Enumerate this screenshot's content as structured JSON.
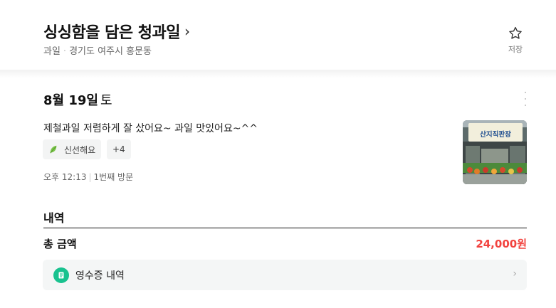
{
  "store": {
    "name": "싱싱함을 담은 청과일",
    "chevron": "›",
    "category": "과일",
    "separator": "·",
    "address": "경기도 여주시 홍문동"
  },
  "save": {
    "label": "저장",
    "icon": "star-outline-icon"
  },
  "visit": {
    "date_bold": "8월 19일",
    "day_of_week": "토",
    "review": "제철과일 저렴하게 잘 샀어요~ 과일 맛있어요~^^",
    "tags": [
      {
        "label": "신선해요",
        "icon": "leaf-icon"
      }
    ],
    "more_tags": "+4",
    "time": "오후 12:13",
    "visit_count": "1번째 방문",
    "thumbnail_sign": "산지직판장"
  },
  "details": {
    "section_title": "내역",
    "total_label": "총 금액",
    "total_amount": "24,000원",
    "receipt_label": "영수증 내역",
    "receipt_chevron": "›"
  },
  "colors": {
    "accent_red": "#f2433f",
    "receipt_green": "#19c28f"
  }
}
